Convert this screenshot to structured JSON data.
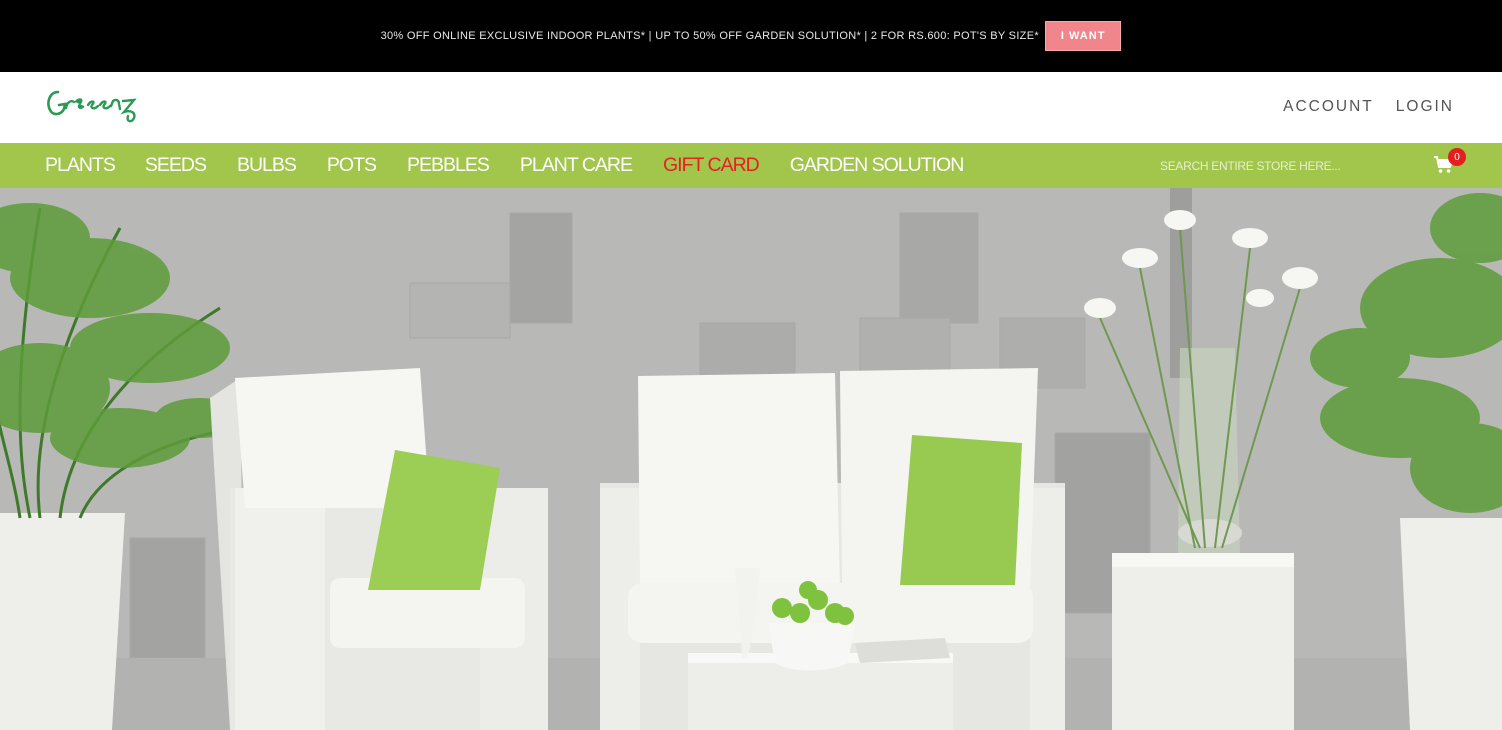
{
  "promo": {
    "text": "30% OFF ONLINE EXCLUSIVE INDOOR PLANTS* | UP TO 50% OFF GARDEN SOLUTION* | 2 FOR RS.600: POT'S BY SIZE*",
    "button_label": "I WANT"
  },
  "header": {
    "logo_text": "Greenz",
    "account_label": "ACCOUNT",
    "login_label": "LOGIN"
  },
  "nav": {
    "items": [
      {
        "label": "PLANTS"
      },
      {
        "label": "SEEDS"
      },
      {
        "label": "BULBS"
      },
      {
        "label": "POTS"
      },
      {
        "label": "PEBBLES"
      },
      {
        "label": "PLANT CARE"
      },
      {
        "label": "GIFT CARD"
      },
      {
        "label": "GARDEN SOLUTION"
      }
    ],
    "search_placeholder": "SEARCH ENTIRE STORE HERE...",
    "cart_count": "0"
  },
  "colors": {
    "promo_bg": "#000000",
    "promo_button": "#f0868c",
    "nav_bg": "#a2c54c",
    "highlight": "#e82020",
    "logo_green": "#2a9a55"
  },
  "icons": {
    "cart": "shopping-cart-icon"
  }
}
